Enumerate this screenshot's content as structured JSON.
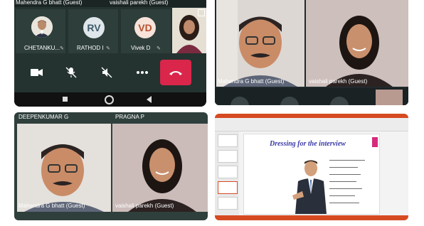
{
  "panel_top_left": {
    "header_names": [
      "Mahendra G bhatt (Guest)",
      "vaishali parekh (Guest)"
    ],
    "participants": [
      {
        "name": "CHETANKU...",
        "avatar_initials": "",
        "avatar_kind": "photo"
      },
      {
        "name": "RATHOD I",
        "avatar_initials": "RV",
        "avatar_kind": "initials"
      },
      {
        "name": "Vivek D",
        "avatar_initials": "VD",
        "avatar_kind": "initials"
      }
    ],
    "controls": [
      "camera-icon",
      "mic-off-icon",
      "speaker-off-icon",
      "more-icon",
      "end-call-icon"
    ],
    "end_call_color": "#d9264a"
  },
  "panel_top_right": {
    "tiles": [
      {
        "name": "Mahendra G bhatt (Guest)"
      },
      {
        "name": "vaishali parekh (Guest)"
      }
    ]
  },
  "panel_bottom_left": {
    "header_names": [
      "DEEPENKUMAR G",
      "PRAGNA P"
    ],
    "tiles": [
      {
        "name": "Mahendra G bhatt (Guest)"
      },
      {
        "name": "vaishali parekh (Guest)"
      }
    ]
  },
  "panel_bottom_right": {
    "slide_title": "Dressing for the interview",
    "accent_color": "#d64a22"
  }
}
